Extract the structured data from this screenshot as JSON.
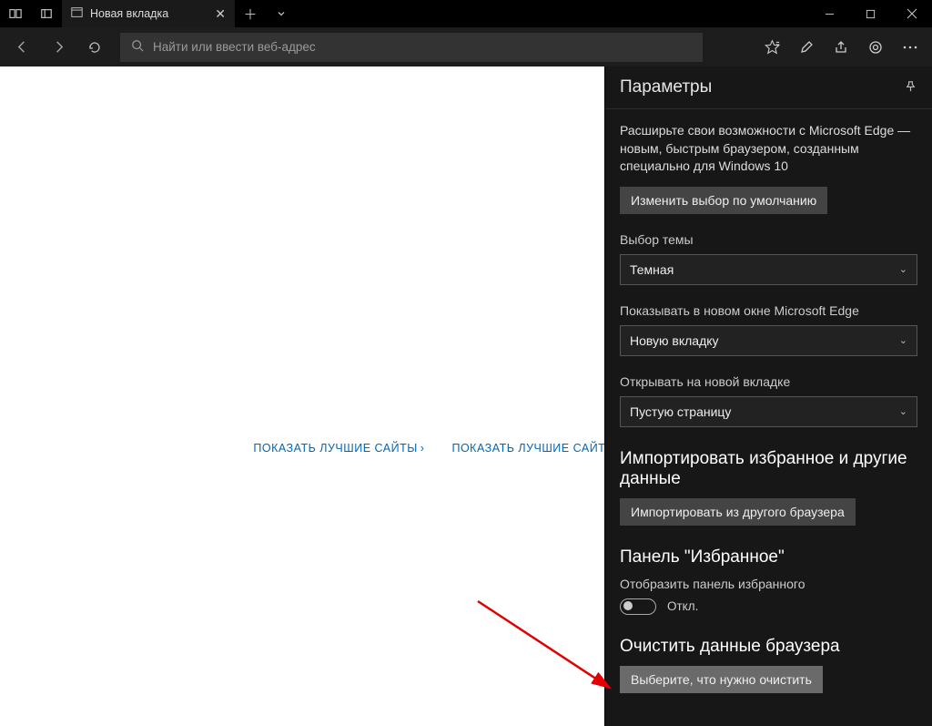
{
  "tabstrip": {
    "tab_title": "Новая вкладка"
  },
  "toolbar": {
    "address_placeholder": "Найти или ввести веб-адрес"
  },
  "ntp": {
    "link1": "ПОКАЗАТЬ ЛУЧШИЕ САЙТЫ",
    "link2": "ПОКАЗАТЬ ЛУЧШИЕ САЙТЫ И ЛЕНТУ"
  },
  "settings": {
    "title": "Параметры",
    "promo": "Расширьте свои возможности с Microsoft Edge — новым, быстрым браузером, созданным специально для Windows 10",
    "change_default_btn": "Изменить выбор по умолчанию",
    "theme_label": "Выбор темы",
    "theme_value": "Темная",
    "open_with_label": "Показывать в новом окне Microsoft Edge",
    "open_with_value": "Новую вкладку",
    "newtab_label": "Открывать на новой вкладке",
    "newtab_value": "Пустую страницу",
    "import_title": "Импортировать избранное и другие данные",
    "import_btn": "Импортировать из другого браузера",
    "favbar_title": "Панель \"Избранное\"",
    "favbar_label": "Отобразить панель избранного",
    "favbar_toggle_label": "Откл.",
    "clear_title": "Очистить данные браузера",
    "clear_btn": "Выберите, что нужно очистить"
  }
}
